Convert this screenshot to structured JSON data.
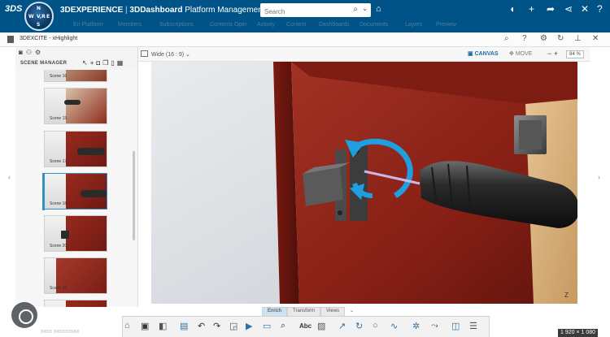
{
  "header": {
    "brand": "3DS",
    "compass": {
      "n": "N",
      "w": "W",
      "e": "E",
      "s": "S",
      "v": "V,R"
    },
    "title_bold": "3DEXPERIENCE",
    "title_sep": " | ",
    "title_app": "3DDashboard",
    "title_sub": " Platform Management",
    "search_placeholder": "Search"
  },
  "tabs_faint": [
    "En Platform",
    "Members",
    "Subscriptions",
    "Contents Oper",
    "Activity",
    "Content",
    "Dashboards",
    "Documents",
    "Layers",
    "Preview"
  ],
  "app": {
    "name": "3DEXCITE - xHighlight"
  },
  "scene_manager": {
    "title": "SCENE MANAGER",
    "scenes": [
      {
        "label": "Scene 16",
        "selected": false
      },
      {
        "label": "Scene 15",
        "selected": false
      },
      {
        "label": "Scene 17",
        "selected": false
      },
      {
        "label": "Scene 18",
        "selected": true
      },
      {
        "label": "Scene 20",
        "selected": false
      },
      {
        "label": "Scene 19",
        "selected": false
      }
    ]
  },
  "viewport": {
    "aspect": "Wide (16 : 9)",
    "canvas": "CANVAS",
    "move": "MOVE",
    "zoom": "84 %",
    "axis_z": "Z"
  },
  "dock": {
    "tabs": [
      "Enrich",
      "Transform",
      "Views"
    ],
    "active_tab": "Enrich",
    "text_tool": "Abc"
  },
  "overlay": {
    "resolution": "1 920 × 1 080",
    "watermark": "xxxx xxxxxxxxx"
  },
  "colors": {
    "header_blue": "#005387",
    "accent_blue": "#368ec4",
    "cabinet_red": "#8e2418",
    "wood": "#d9b07a"
  }
}
